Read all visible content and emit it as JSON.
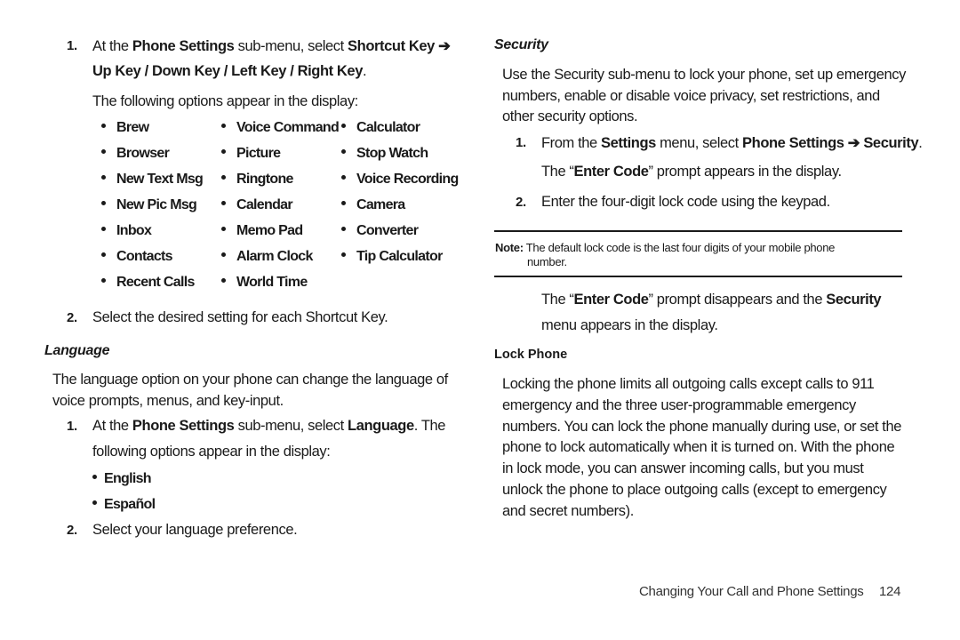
{
  "left": {
    "shortcut_step1": {
      "number": "1.",
      "pre": "At the ",
      "b1": "Phone Settings",
      "mid": " sub-menu, select ",
      "b2": "Shortcut Key ➔",
      "line2": "Up Key / Down Key / Left Key / Right Key",
      "line2_end": ".",
      "line3": "The following options appear in the display:"
    },
    "shortcut_options": [
      [
        "Brew",
        "Voice Command",
        "Calculator"
      ],
      [
        "Browser",
        "Picture",
        "Stop Watch"
      ],
      [
        "New Text Msg",
        "Ringtone",
        "Voice Recording"
      ],
      [
        "New Pic Msg",
        "Calendar",
        "Camera"
      ],
      [
        "Inbox",
        "Memo Pad",
        "Converter"
      ],
      [
        "Contacts",
        "Alarm Clock",
        "Tip Calculator"
      ],
      [
        "Recent Calls",
        "World Time",
        ""
      ]
    ],
    "shortcut_step2": {
      "number": "2.",
      "text": "Select the desired setting for each Shortcut Key."
    },
    "language_heading": "Language",
    "language_para_l1": "The language option on your phone can change the language of",
    "language_para_l2": "voice prompts, menus, and key-input.",
    "language_step1": {
      "number": "1.",
      "pre": "At the ",
      "b1": "Phone Settings",
      "mid": " sub-menu, select ",
      "b2": "Language",
      "post": ". The",
      "line2": "following options appear in the display:"
    },
    "language_options": [
      "English",
      "Español"
    ],
    "language_step2": {
      "number": "2.",
      "text": "Select your language preference."
    }
  },
  "right": {
    "security_heading": "Security",
    "security_para": [
      "Use the Security sub-menu to lock your phone, set up emergency",
      "numbers, enable or disable voice privacy, set restrictions, and",
      "other security options."
    ],
    "step1": {
      "number": "1.",
      "pre": "From the ",
      "b1": "Settings",
      "mid": " menu, select ",
      "b2": "Phone Settings ➔ Security",
      "post": ".",
      "line2_pre": "The “",
      "line2_b": "Enter Code",
      "line2_post": "” prompt appears in the display."
    },
    "step2": {
      "number": "2.",
      "text": "Enter the four-digit lock code using the keypad."
    },
    "note": {
      "label": "Note:",
      "line1": " The default lock code is the last four digits of your mobile phone",
      "line2": "number."
    },
    "after_note": {
      "pre": "The “",
      "b1": "Enter Code",
      "mid": "” prompt disappears and the ",
      "b2": "Security",
      "line2": "menu appears in the display."
    },
    "lock_phone_heading": "Lock Phone",
    "lock_phone_para": [
      "Locking the phone limits all outgoing calls except calls to 911",
      "emergency and the three user-programmable emergency",
      "numbers. You can lock the phone manually during use, or set the",
      "phone to lock automatically when it is turned on. With the phone",
      "in lock mode, you can answer incoming calls, but you must",
      "unlock the phone to place outgoing calls (except to emergency",
      "and secret numbers)."
    ]
  },
  "footer": {
    "section_title": "Changing Your Call and Phone Settings",
    "page_number": "124"
  }
}
